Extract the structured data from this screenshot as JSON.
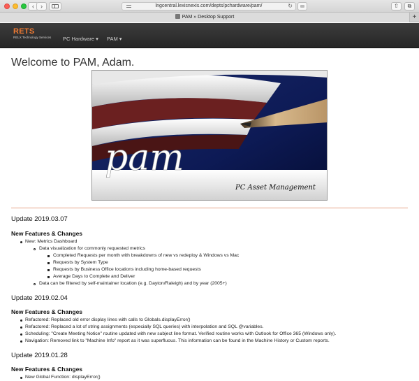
{
  "browser": {
    "url": "lngcentral.lexisnexis.com/depts/pchardware/pam/",
    "tab_title": "PAM » Desktop Support",
    "back_icon": "‹",
    "forward_icon": "›",
    "reload_icon": "↻",
    "share_icon": "⇧",
    "tabs_icon": "⧉",
    "new_tab_icon": "+"
  },
  "site": {
    "brand": "RETS",
    "brand_sub": "RELX Technology Services",
    "nav": [
      {
        "label": "PC Hardware ▾"
      },
      {
        "label": "PAM ▾"
      }
    ],
    "accent": "#f07a32"
  },
  "main": {
    "welcome": "Welcome to PAM, Adam.",
    "hero": {
      "logo_text": "pam",
      "caption": "PC Asset Management"
    },
    "updates": [
      {
        "title": "Update 2019.03.07",
        "section": "New Features & Changes",
        "items": [
          "New: Metrics Dashboard",
          "Data visualization for commonly requested metrics",
          "Completed Requests per month with breakdowns of new vs redeploy & Windows vs Mac",
          "Requests by System Type",
          "Requests by Business Office locations including home-based requests",
          "Average Days to Complete and Deliver",
          "Data can be filtered by self-maintainer location (e.g. Dayton/Raleigh) and by year (2005+)"
        ]
      },
      {
        "title": "Update 2019.02.04",
        "section": "New Features & Changes",
        "items": [
          "Refactored: Replaced old error display lines with calls to Globals.displayError()",
          "Refactored: Replaced a lot of string assignments (especially SQL queries) with interpolation and SQL @variables.",
          "Scheduling: \"Create Meeting Notice\" routine updated with new subject line format. Verified routine works with Outlook for Office 365 (Windows only).",
          "Navigation: Removed link to \"Machine Info\" report as it was superfluous. This information can be found in the Machine History or Custom reports."
        ]
      },
      {
        "title": "Update 2019.01.28",
        "section": "New Features & Changes",
        "items": [
          "New Global Function: displayError()"
        ]
      }
    ]
  }
}
